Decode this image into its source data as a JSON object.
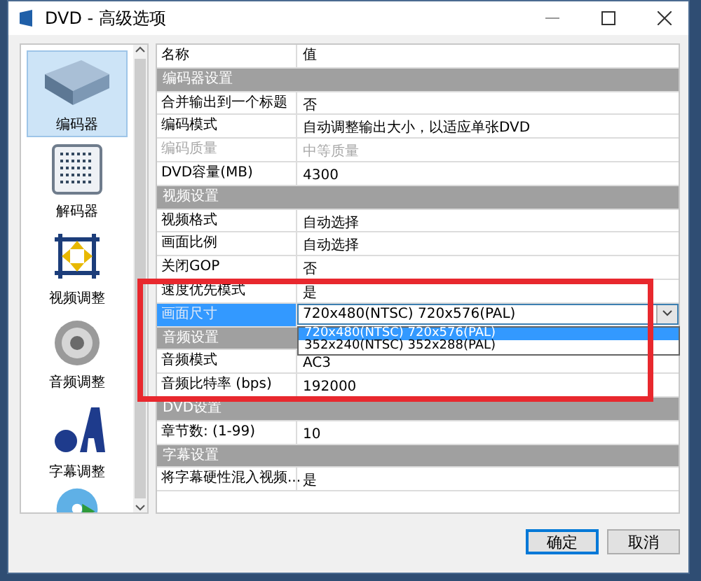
{
  "window": {
    "title": "DVD - 高级选项"
  },
  "sidebar": {
    "items": [
      {
        "kind": "encoder",
        "label": "编码器",
        "selected": true
      },
      {
        "kind": "decoder",
        "label": "解码器",
        "selected": false
      },
      {
        "kind": "video",
        "label": "视频调整",
        "selected": false
      },
      {
        "kind": "audio",
        "label": "音频调整",
        "selected": false
      },
      {
        "kind": "subtitle",
        "label": "字幕调整",
        "selected": false
      },
      {
        "kind": "disc",
        "selected": false
      }
    ]
  },
  "grid": {
    "columns": [
      "名称",
      "值"
    ],
    "rows": [
      {
        "kind": "section",
        "name": "编码器设置"
      },
      {
        "kind": "property",
        "name": "合并输出到一个标题",
        "value": "否",
        "disabled": false
      },
      {
        "kind": "property",
        "name": "编码模式",
        "value": "自动调整输出大小，以适应单张DVD",
        "disabled": false
      },
      {
        "kind": "property",
        "name": "编码质量",
        "value": "中等质量",
        "disabled": true
      },
      {
        "kind": "property",
        "name": "DVD容量(MB)",
        "value": "4300",
        "disabled": false
      },
      {
        "kind": "section",
        "name": "视频设置"
      },
      {
        "kind": "property",
        "name": "视频格式",
        "value": "自动选择",
        "disabled": false
      },
      {
        "kind": "property",
        "name": "画面比例",
        "value": "自动选择",
        "disabled": false
      },
      {
        "kind": "property",
        "name": "关闭GOP",
        "value": "否",
        "disabled": false
      },
      {
        "kind": "property",
        "name": "速度优先模式",
        "value": "是",
        "disabled": false
      },
      {
        "kind": "combo",
        "name": "画面尺寸",
        "value": "720x480(NTSC) 720x576(PAL)",
        "selected": true,
        "expanded": true,
        "options": [
          {
            "label": "720x480(NTSC) 720x576(PAL)",
            "selected": true
          },
          {
            "label": "352x240(NTSC) 352x288(PAL)",
            "selected": false
          }
        ]
      },
      {
        "kind": "section",
        "name": "音频设置"
      },
      {
        "kind": "property",
        "name": "音频模式",
        "value": "AC3",
        "disabled": false
      },
      {
        "kind": "property",
        "name": "音频比特率 (bps)",
        "value": "192000",
        "disabled": false
      },
      {
        "kind": "section",
        "name": "DVD设置"
      },
      {
        "kind": "property",
        "name": "章节数: (1-99)",
        "value": "10",
        "disabled": false
      },
      {
        "kind": "section",
        "name": "字幕设置"
      },
      {
        "kind": "property",
        "name": "将字幕硬性混入视频...",
        "value": "是",
        "disabled": false
      }
    ]
  },
  "annotations": [
    {
      "kind": "frame"
    }
  ],
  "buttons": [
    {
      "label": "确定",
      "default": true
    },
    {
      "label": "取消",
      "default": false
    }
  ]
}
